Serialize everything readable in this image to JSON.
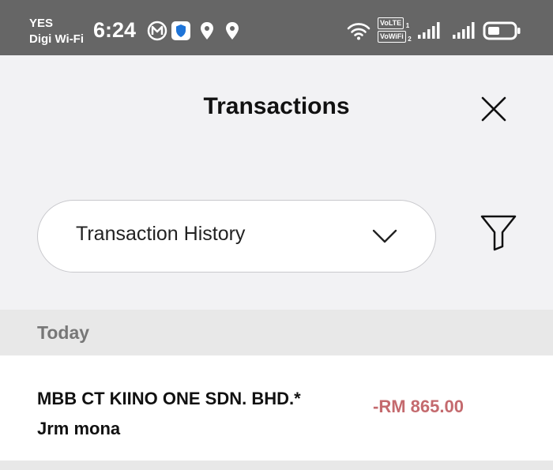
{
  "status_bar": {
    "carrier_top": "YES",
    "carrier_bottom": "Digi Wi-Fi",
    "time": "6:24",
    "volte1": "VoLTE",
    "volte1_sim": "1",
    "volte2": "VoWiFi",
    "volte2_sim": "2",
    "icons": [
      "m-icon",
      "shield-icon",
      "location-icon",
      "location-icon",
      "wifi-icon",
      "signal-icon",
      "signal-icon",
      "battery-icon"
    ]
  },
  "header": {
    "title": "Transactions",
    "close_icon": "close-icon"
  },
  "filter": {
    "selected": "Transaction History",
    "dropdown_icon": "chevron-down-icon",
    "filter_icon": "filter-icon"
  },
  "sections": [
    {
      "title": "Today",
      "transactions": [
        {
          "line1": "MBB CT KIINO ONE SDN. BHD.*",
          "line2": "Jrm mona",
          "amount": "-RM 865.00"
        }
      ]
    }
  ],
  "colors": {
    "status_bar": "#666666",
    "background": "#f2f2f4",
    "debit_amount": "#c46a6e",
    "section_header": "#e8e8e8"
  }
}
